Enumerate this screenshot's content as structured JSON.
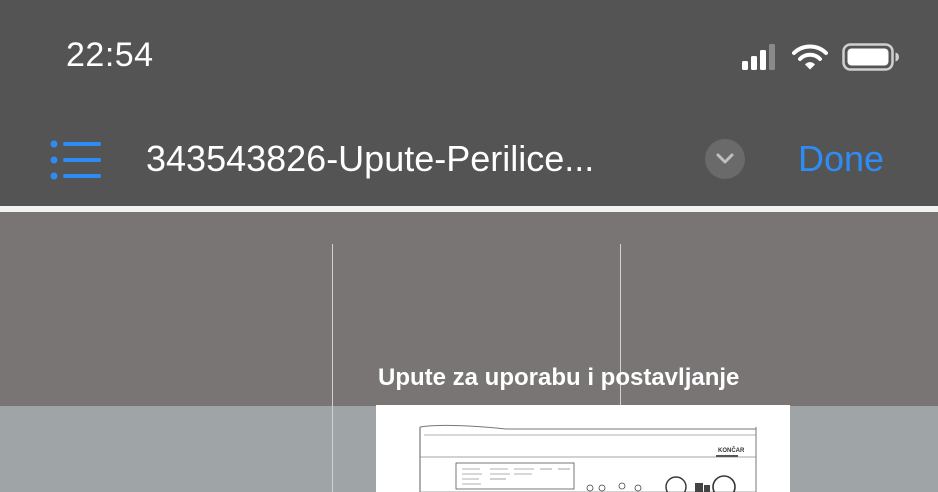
{
  "status_bar": {
    "time": "22:54",
    "icons": [
      "cellular-signal-icon",
      "wifi-icon",
      "battery-icon"
    ]
  },
  "nav": {
    "list_icon": "list-icon",
    "title": "343543826-Upute-Perilice...",
    "chevron_icon": "chevron-down-icon",
    "done_label": "Done"
  },
  "document": {
    "heading": "Upute za uporabu i postavljanje",
    "appliance_brand": "KONČAR"
  },
  "colors": {
    "bar_bg": "#545454",
    "accent": "#2e8cf6",
    "doc_top": "#797575",
    "doc_bottom": "#9fa4a6"
  }
}
